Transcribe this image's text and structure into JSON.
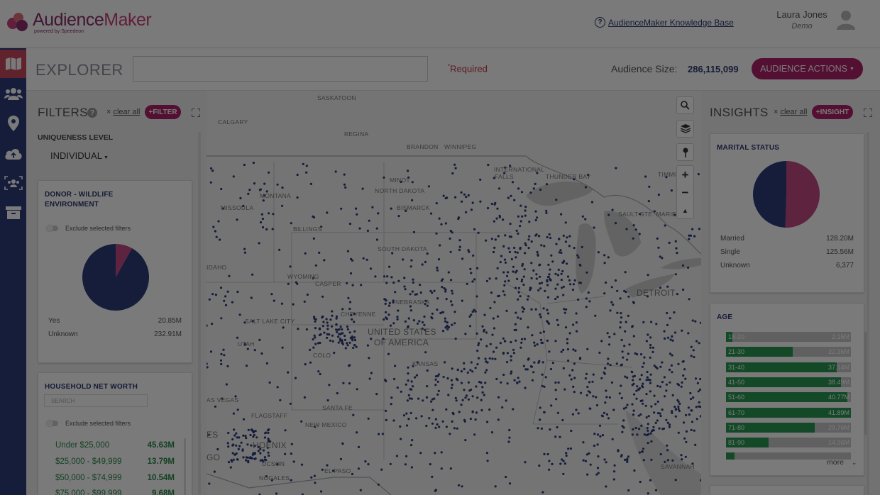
{
  "app": {
    "name_part1": "Audience",
    "name_part2": "Maker",
    "tagline": "powered by Speedeon"
  },
  "header": {
    "kb_link": "AudienceMaker Knowledge Base",
    "user_name": "Laura Jones",
    "user_role": "Demo"
  },
  "sidebar": {
    "items": [
      {
        "icon": "map-icon",
        "active": true
      },
      {
        "icon": "people-icon",
        "active": false
      },
      {
        "icon": "location-pin-icon",
        "active": false
      },
      {
        "icon": "cloud-upload-icon",
        "active": false
      },
      {
        "icon": "audience-group-icon",
        "active": false
      },
      {
        "icon": "archive-icon",
        "active": false
      }
    ]
  },
  "explorer": {
    "title": "EXPLORER",
    "input_value": "",
    "required_mark": "*",
    "required_text": "Required",
    "audience_size_label": "Audience Size:",
    "audience_size_value": "286,115,099",
    "audience_actions_label": "AUDIENCE ACTIONS"
  },
  "filters": {
    "title": "FILTERS",
    "clear_all": "clear all",
    "add_filter": "+FILTER",
    "uniqueness_label": "UNIQUENESS LEVEL",
    "uniqueness_value": "INDIVIDUAL",
    "donor_card": {
      "title_line1": "DONOR - WILDLIFE",
      "title_line2": "ENVIRONMENT",
      "exclude_label": "Exclude selected filters",
      "rows": [
        {
          "label": "Yes",
          "value": "20.85M",
          "pct": 0.082
        },
        {
          "label": "Unknown",
          "value": "232.91M",
          "pct": 0.918
        }
      ]
    },
    "networth_card": {
      "title": "HOUSEHOLD NET WORTH",
      "search_placeholder": "SEARCH",
      "exclude_label": "Exclude selected filters",
      "rows": [
        {
          "label": "Under $25,000",
          "value": "45.63M"
        },
        {
          "label": "$25,000 - $49,999",
          "value": "13.79M"
        },
        {
          "label": "$50,000 - $74,999",
          "value": "10.54M"
        },
        {
          "label": "$75,000 - $99,999",
          "value": "9.68M"
        }
      ]
    }
  },
  "map": {
    "labels": {
      "saskatoon": "SASKATOON",
      "calgary": "CALGARY",
      "regina": "REGINA",
      "brandon": "BRANDON",
      "winnipeg": "WINNIPEG",
      "minot": "MINOT",
      "montana": "MONTANA",
      "north_dakota": "NORTH DAKOTA",
      "bismarck": "BISMARCK",
      "international_falls_1": "INTERNATIONAL",
      "international_falls_2": "FALLS",
      "thunder_bay": "THUNDER BAY",
      "timmins": "TIMMI",
      "missoula": "MISSOULA",
      "billings": "BILLINGS",
      "south_dakota": "SOUTH DAKOTA",
      "sault": "SAULT STE. MARIE",
      "idaho": "IDAHO",
      "wyoming": "WYOMING",
      "casper": "CASPER",
      "nebraska": "NEBRASKA",
      "cheyenne": "CHEYENNE",
      "salt_lake": "SALT LAKE CITY",
      "utah": "UTAH",
      "usa_1": "UNITED STATES",
      "usa_2": "OF AMERICA",
      "colorado": "COLO",
      "kansas": "KANSAS",
      "las_vegas": "AS VEGAS",
      "flagstaff": "FLAGSTAFF",
      "santa_fe": "SANTA FE",
      "new_mexico": "NEW MEXICO",
      "phoenix": "HOENIX",
      "tucson": "UCSON",
      "el_paso": "EL PASO",
      "nogales": "NOGALES",
      "es": "ES",
      "go": "GO",
      "detroit": "DETROIT",
      "savannah": "SAVANNAH"
    },
    "zoom_in": "+",
    "zoom_out": "−",
    "north": "▲"
  },
  "insights": {
    "title": "INSIGHTS",
    "clear_all": "clear all",
    "add_insight": "+INSIGHT",
    "marital": {
      "title": "MARITAL STATUS",
      "rows": [
        {
          "label": "Married",
          "value": "128.20M",
          "pct": 0.505
        },
        {
          "label": "Single",
          "value": "125.56M",
          "pct": 0.495
        },
        {
          "label": "Unknown",
          "value": "6,377",
          "pct": 0.0
        }
      ]
    },
    "age": {
      "title": "AGE",
      "more": "more",
      "rows": [
        {
          "label": "18-20",
          "value": "2.15M",
          "pct": 0.05
        },
        {
          "label": "21-30",
          "value": "22.36M",
          "pct": 0.535
        },
        {
          "label": "31-40",
          "value": "37.14M",
          "pct": 0.887
        },
        {
          "label": "41-50",
          "value": "38.49M",
          "pct": 0.919
        },
        {
          "label": "51-60",
          "value": "40.77M",
          "pct": 0.973
        },
        {
          "label": "61-70",
          "value": "41.89M",
          "pct": 1.0
        },
        {
          "label": "71-80",
          "value": "29.76M",
          "pct": 0.71
        },
        {
          "label": "81-90",
          "value": "14.36M",
          "pct": 0.343
        },
        {
          "label": "",
          "value": "",
          "pct": 0.07
        }
      ]
    }
  },
  "colors": {
    "brand": "#b0226a",
    "sidebar": "#2c3e7c",
    "accent_red": "#c8475c",
    "navy": "#2b3a70",
    "green": "#2a9a54",
    "pie_pink": "#c24a84",
    "pie_navy": "#2c3e7c"
  }
}
